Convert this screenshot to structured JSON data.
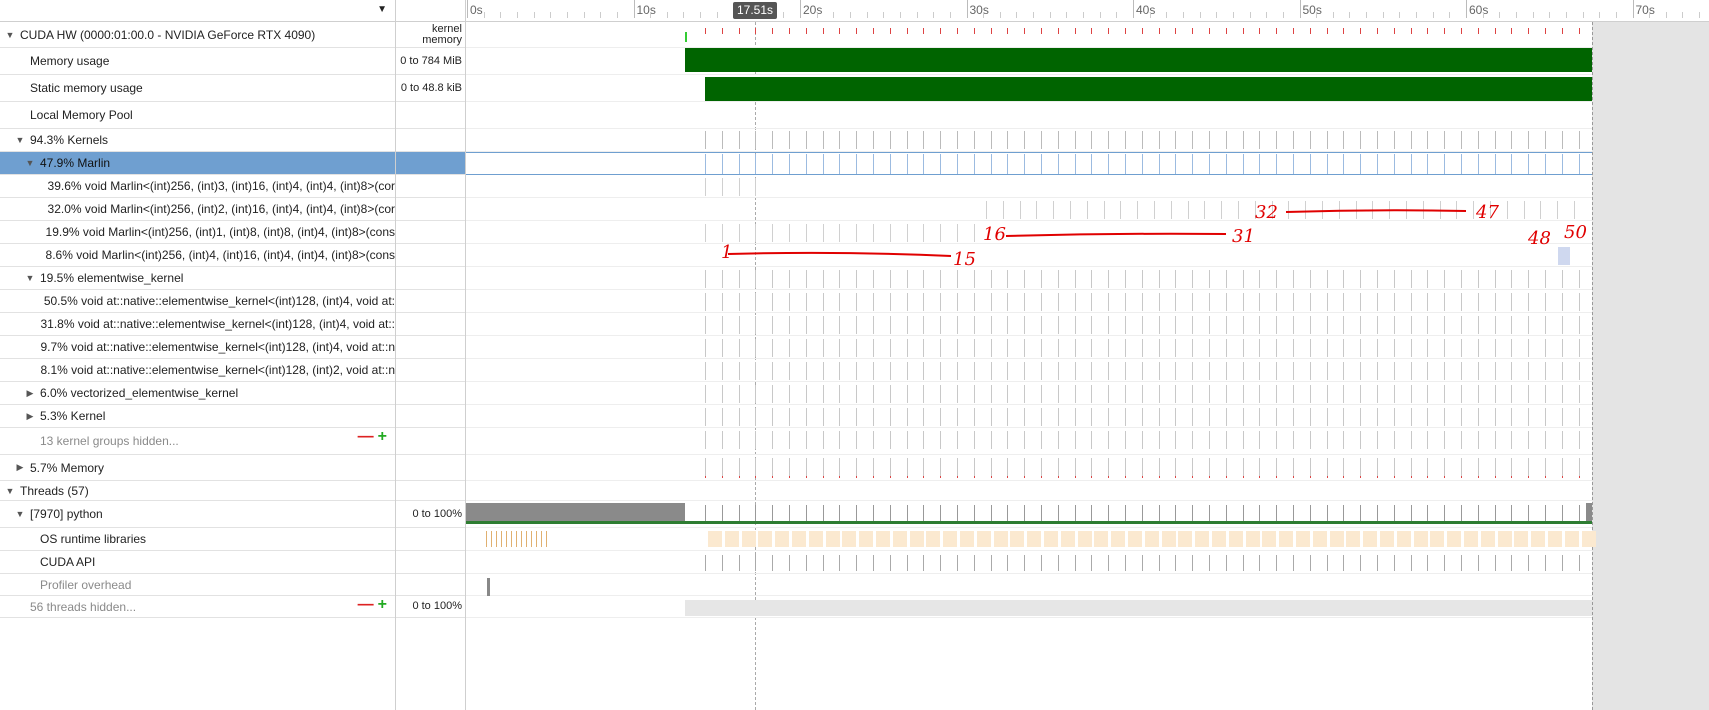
{
  "timeline": {
    "cursor_label": "17.51s",
    "ticks": [
      "0s",
      "10s",
      "20s",
      "30s",
      "40s",
      "50s",
      "60s",
      "70s"
    ]
  },
  "tree": {
    "header_dropdown_icon": "caret-down-icon",
    "rows": [
      {
        "label": "CUDA HW (0000:01:00.0 - NVIDIA GeForce RTX 4090)",
        "scale": "kernel memory"
      },
      {
        "label": "Memory usage",
        "scale": "0 to 784 MiB"
      },
      {
        "label": "Static memory usage",
        "scale": "0 to 48.8 kiB"
      },
      {
        "label": "Local Memory Pool",
        "scale": ""
      },
      {
        "label": "94.3% Kernels",
        "scale": ""
      },
      {
        "label": "47.9% Marlin",
        "scale": ""
      },
      {
        "label": "39.6% void Marlin<(int)256, (int)3, (int)16, (int)4, (int)4, (int)8>(cor",
        "scale": ""
      },
      {
        "label": "32.0% void Marlin<(int)256, (int)2, (int)16, (int)4, (int)4, (int)8>(cor",
        "scale": ""
      },
      {
        "label": "19.9% void Marlin<(int)256, (int)1, (int)8, (int)8, (int)4, (int)8>(cons",
        "scale": ""
      },
      {
        "label": "8.6% void Marlin<(int)256, (int)4, (int)16, (int)4, (int)4, (int)8>(cons",
        "scale": ""
      },
      {
        "label": "19.5% elementwise_kernel",
        "scale": ""
      },
      {
        "label": "50.5% void at::native::elementwise_kernel<(int)128, (int)4, void at:",
        "scale": ""
      },
      {
        "label": "31.8% void at::native::elementwise_kernel<(int)128, (int)4, void at::",
        "scale": ""
      },
      {
        "label": "9.7% void at::native::elementwise_kernel<(int)128, (int)4, void at::n",
        "scale": ""
      },
      {
        "label": "8.1% void at::native::elementwise_kernel<(int)128, (int)2, void at::n",
        "scale": ""
      },
      {
        "label": "6.0% vectorized_elementwise_kernel",
        "scale": ""
      },
      {
        "label": "5.3% Kernel",
        "scale": ""
      },
      {
        "label": "13 kernel groups hidden...",
        "scale": ""
      },
      {
        "label": "5.7% Memory",
        "scale": ""
      },
      {
        "label": "Threads (57)",
        "scale": ""
      },
      {
        "label": "[7970] python",
        "scale": "0 to 100%"
      },
      {
        "label": "OS runtime libraries",
        "scale": ""
      },
      {
        "label": "CUDA API",
        "scale": ""
      },
      {
        "label": "Profiler overhead",
        "scale": ""
      },
      {
        "label": "56 threads hidden...",
        "scale": "0 to 100%"
      }
    ],
    "minus_symbol": "—",
    "plus_symbol": "+"
  },
  "annotations": {
    "row_32": {
      "start": "32",
      "end": "47"
    },
    "row_19": {
      "start": "16",
      "end": "31"
    },
    "row_19_end": {
      "start": "48",
      "end": "50"
    },
    "row_8": {
      "start": "1",
      "end": "15"
    }
  },
  "colors": {
    "selected": "#6f9fd0",
    "memory_green": "#006400",
    "annotation_red": "#e00000"
  }
}
